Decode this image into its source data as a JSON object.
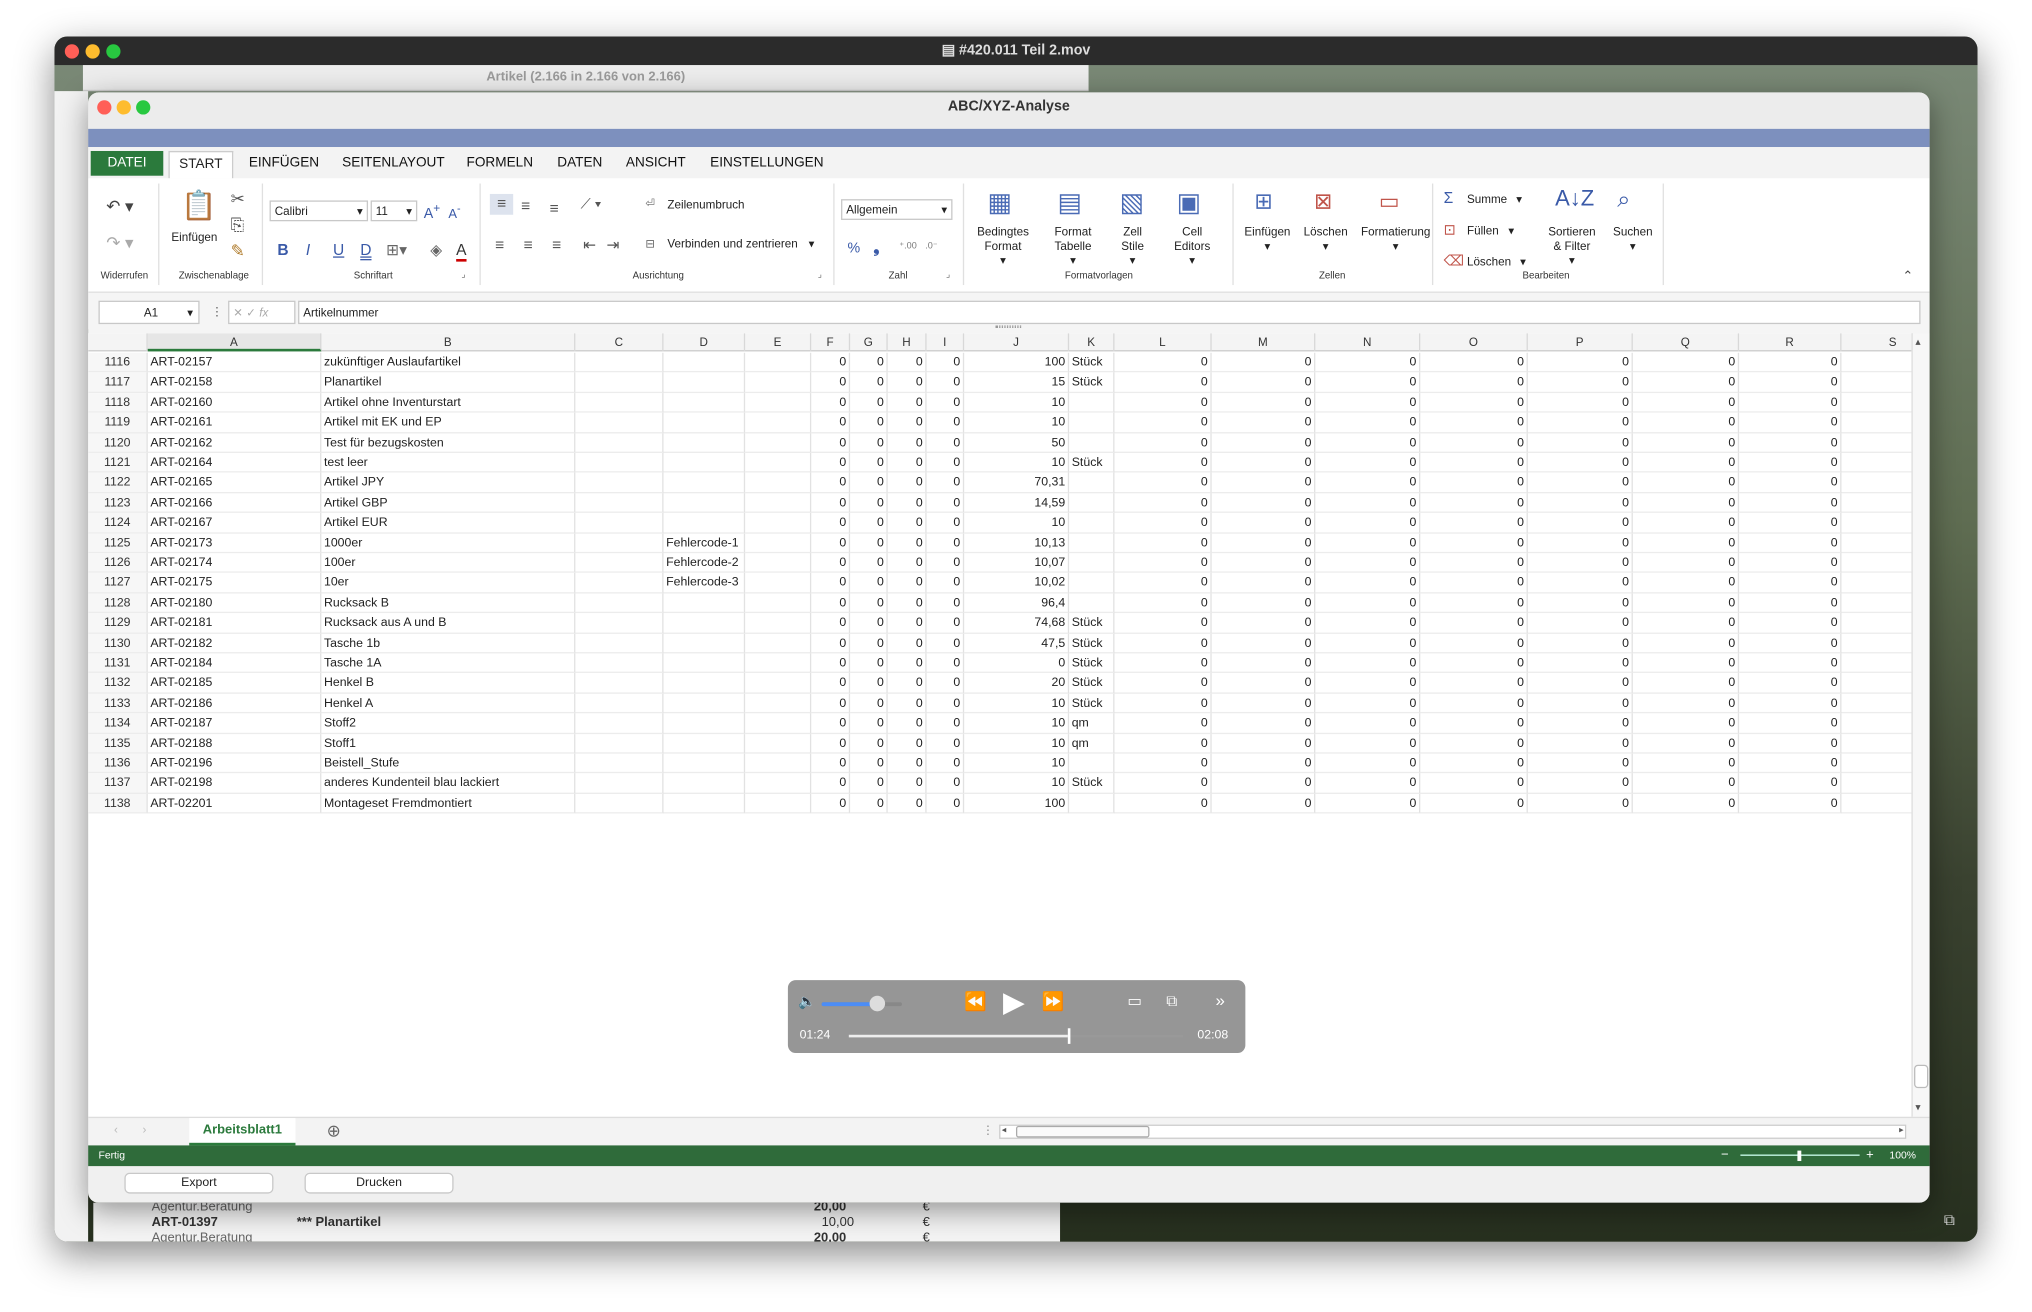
{
  "player": {
    "title": "#420.011 Teil 2.mov",
    "current_time": "01:24",
    "total_time": "02:08",
    "progress": 0.656,
    "volume": 0.7
  },
  "background_window": {
    "title": "Artikel (2.166 in 2.166 von 2.166)",
    "peek_rows": [
      {
        "a": "Agentur.Beratung",
        "b": "",
        "val": "20,00",
        "cur": "€"
      },
      {
        "a": "ART-01397",
        "b": "*** Planartikel",
        "val": "10,00",
        "cur": "€"
      },
      {
        "a": "Agentur.Beratung",
        "b": "",
        "val": "20,00",
        "cur": "€"
      }
    ]
  },
  "window": {
    "title": "ABC/XYZ-Analyse"
  },
  "ribbon_tabs": [
    "DATEI",
    "START",
    "EINFÜGEN",
    "SEITENLAYOUT",
    "FORMELN",
    "DATEN",
    "ANSICHT",
    "EINSTELLUNGEN"
  ],
  "ribbon": {
    "groups": {
      "undo": "Widerrufen",
      "clipboard": "Zwischenablage",
      "font": "Schriftart",
      "align": "Ausrichtung",
      "number": "Zahl",
      "styles": "Formatvorlagen",
      "cells": "Zellen",
      "edit": "Bearbeiten"
    },
    "paste_label": "Einfügen",
    "font_name": "Calibri",
    "font_size": "11",
    "wrap_label": "Zeilenumbruch",
    "merge_label": "Verbinden und zentrieren",
    "number_format": "Allgemein",
    "cond_format_1": "Bedingtes",
    "cond_format_2": "Format",
    "format_table_1": "Format",
    "format_table_2": "Tabelle",
    "cell_styles_1": "Zell",
    "cell_styles_2": "Stile",
    "cell_editors_1": "Cell",
    "cell_editors_2": "Editors",
    "insert_label": "Einfügen",
    "delete_label": "Löschen",
    "format_label": "Formatierung",
    "sum_label": "Summe",
    "fill_label": "Füllen",
    "clear_label": "Löschen",
    "sort_1": "Sortieren",
    "sort_2": "& Filter",
    "search_label": "Suchen"
  },
  "formula_bar": {
    "cell_ref": "A1",
    "fx": "fx",
    "content": "Artikelnummer"
  },
  "columns": [
    "A",
    "B",
    "C",
    "D",
    "E",
    "F",
    "G",
    "H",
    "I",
    "J",
    "K",
    "L",
    "M",
    "N",
    "O",
    "P",
    "Q",
    "R",
    "S"
  ],
  "rows": [
    {
      "n": "1116",
      "a": "ART-02157",
      "b": "zukünftiger Auslaufartikel",
      "d": "",
      "j": "100",
      "k": "Stück"
    },
    {
      "n": "1117",
      "a": "ART-02158",
      "b": "Planartikel",
      "d": "",
      "j": "15",
      "k": "Stück"
    },
    {
      "n": "1118",
      "a": "ART-02160",
      "b": "Artikel ohne Inventurstart",
      "d": "",
      "j": "10",
      "k": ""
    },
    {
      "n": "1119",
      "a": "ART-02161",
      "b": "Artikel mit EK und EP",
      "d": "",
      "j": "10",
      "k": ""
    },
    {
      "n": "1120",
      "a": "ART-02162",
      "b": "Test für bezugskosten",
      "d": "",
      "j": "50",
      "k": ""
    },
    {
      "n": "1121",
      "a": "ART-02164",
      "b": "test leer",
      "d": "",
      "j": "10",
      "k": "Stück"
    },
    {
      "n": "1122",
      "a": "ART-02165",
      "b": "Artikel JPY",
      "d": "",
      "j": "70,31",
      "k": ""
    },
    {
      "n": "1123",
      "a": "ART-02166",
      "b": "Artikel GBP",
      "d": "",
      "j": "14,59",
      "k": ""
    },
    {
      "n": "1124",
      "a": "ART-02167",
      "b": "Artikel EUR",
      "d": "",
      "j": "10",
      "k": ""
    },
    {
      "n": "1125",
      "a": "ART-02173",
      "b": "1000er",
      "d": "Fehlercode-1",
      "j": "10,13",
      "k": ""
    },
    {
      "n": "1126",
      "a": "ART-02174",
      "b": "100er",
      "d": "Fehlercode-2",
      "j": "10,07",
      "k": ""
    },
    {
      "n": "1127",
      "a": "ART-02175",
      "b": "10er",
      "d": "Fehlercode-3",
      "j": "10,02",
      "k": ""
    },
    {
      "n": "1128",
      "a": "ART-02180",
      "b": "Rucksack B",
      "d": "",
      "j": "96,4",
      "k": ""
    },
    {
      "n": "1129",
      "a": "ART-02181",
      "b": "Rucksack aus A und B",
      "d": "",
      "j": "74,68",
      "k": "Stück"
    },
    {
      "n": "1130",
      "a": "ART-02182",
      "b": "Tasche 1b",
      "d": "",
      "j": "47,5",
      "k": "Stück"
    },
    {
      "n": "1131",
      "a": "ART-02184",
      "b": "Tasche 1A",
      "d": "",
      "j": "0",
      "k": "Stück"
    },
    {
      "n": "1132",
      "a": "ART-02185",
      "b": "Henkel B",
      "d": "",
      "j": "20",
      "k": "Stück"
    },
    {
      "n": "1133",
      "a": "ART-02186",
      "b": "Henkel A",
      "d": "",
      "j": "10",
      "k": "Stück"
    },
    {
      "n": "1134",
      "a": "ART-02187",
      "b": "Stoff2",
      "d": "",
      "j": "10",
      "k": "qm"
    },
    {
      "n": "1135",
      "a": "ART-02188",
      "b": "Stoff1",
      "d": "",
      "j": "10",
      "k": "qm"
    },
    {
      "n": "1136",
      "a": "ART-02196",
      "b": "Beistell_Stufe",
      "d": "",
      "j": "10",
      "k": ""
    },
    {
      "n": "1137",
      "a": "ART-02198",
      "b": "anderes Kundenteil blau lackiert",
      "d": "",
      "j": "10",
      "k": "Stück"
    },
    {
      "n": "1138",
      "a": "ART-02201",
      "b": "Montageset Fremdmontiert",
      "d": "",
      "j": "100",
      "k": ""
    }
  ],
  "zero_value": "0",
  "sheet_tab": "Arbeitsblatt1",
  "status": {
    "text": "Fertig",
    "zoom": "100%"
  },
  "buttons": {
    "export": "Export",
    "print": "Drucken"
  },
  "colors": {
    "accent_green": "#2b7a3c",
    "band_blue": "#7d90be",
    "status_green": "#2f6b3a"
  }
}
